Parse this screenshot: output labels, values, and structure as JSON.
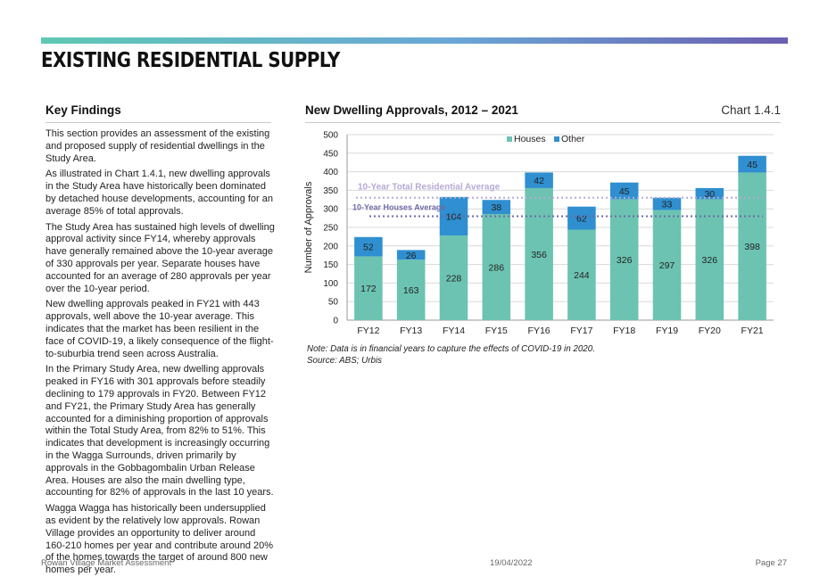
{
  "page": {
    "title": "EXISTING RESIDENTIAL SUPPLY",
    "accent_colors": [
      "#5fc8b4",
      "#6aa7d6",
      "#6b5fb0"
    ]
  },
  "key_findings": {
    "heading": "Key Findings",
    "paragraphs": [
      "This section provides an assessment of the existing and proposed supply of residential dwellings in the Study Area.",
      "As illustrated in Chart 1.4.1, new dwelling approvals in the Study Area have historically been dominated by detached house developments, accounting for an average 85% of total approvals.",
      "The Study Area has sustained high levels of dwelling approval activity since FY14, whereby approvals have generally remained above the 10-year average of 330 approvals per year. Separate houses have accounted for an average of 280 approvals per year over the 10-year period.",
      "New dwelling approvals peaked in FY21 with 443 approvals, well above the 10-year average. This indicates that the market has been resilient in the face of COVID-19, a likely consequence of the flight-to-suburbia trend seen across Australia.",
      "In the Primary Study Area, new dwelling approvals peaked in FY16 with 301 approvals before steadily declining to 179 approvals in FY20. Between FY12 and FY21, the Primary Study Area has generally accounted for a diminishing proportion of approvals within the Total Study Area, from 82% to 51%. This indicates that development is increasingly occurring in the Wagga Surrounds, driven primarily by approvals in the Gobbagombalin Urban Release Area. Houses are also the main dwelling type, accounting for 82% of approvals in the last 10 years.",
      "Wagga Wagga has historically been undersupplied as evident by the relatively low approvals. Rowan Village provides an opportunity to deliver around 160-210 homes per year and contribute around 20% of the homes towards the target of around 800 new homes per year."
    ]
  },
  "chart_section": {
    "heading": "New Dwelling Approvals, 2012 – 2021",
    "chart_number": "Chart 1.4.1",
    "note": "Note: Data is in financial years to capture the effects of COVID-19 in 2020.",
    "source": "Source: ABS; Urbis"
  },
  "chart_data": {
    "type": "bar",
    "stacked": true,
    "categories": [
      "FY12",
      "FY13",
      "FY14",
      "FY15",
      "FY16",
      "FY17",
      "FY18",
      "FY19",
      "FY20",
      "FY21"
    ],
    "series": [
      {
        "name": "Houses",
        "values": [
          172,
          163,
          228,
          286,
          356,
          244,
          326,
          297,
          326,
          398
        ],
        "color": "#6cc3b1"
      },
      {
        "name": "Other",
        "values": [
          52,
          26,
          104,
          38,
          42,
          62,
          45,
          33,
          30,
          45
        ],
        "color": "#2f8fd0"
      }
    ],
    "ylabel": "Number of Approvals",
    "ylim": [
      0,
      500
    ],
    "yticks": [
      0,
      50,
      100,
      150,
      200,
      250,
      300,
      350,
      400,
      450,
      500
    ],
    "legend_position": "top-center",
    "grid": true,
    "reference_lines": [
      {
        "label": "10-Year Total Residential Average",
        "value": 330,
        "color": "#b7a9d6"
      },
      {
        "label": "10-Year Houses Average",
        "value": 280,
        "color": "#6e6aa8"
      }
    ]
  },
  "footer": {
    "left": "Rowan Village Market Assessment",
    "center": "19/04/2022",
    "right": "Page 27"
  }
}
